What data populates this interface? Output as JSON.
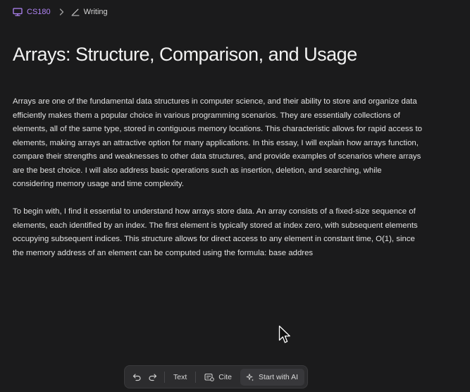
{
  "breadcrumb": {
    "course": "CS180",
    "document": "Writing"
  },
  "document": {
    "title": "Arrays: Structure, Comparison, and Usage",
    "paragraphs": [
      "Arrays are one of the fundamental data structures in computer science, and their ability to store and organize data efficiently makes them a popular choice in various programming scenarios. They are essentially collections of elements, all of the same type, stored in contiguous memory locations. This characteristic allows for rapid access to elements, making arrays an attractive option for many applications. In this essay, I will explain how arrays function, compare their strengths and weaknesses to other data structures, and provide examples of scenarios where arrays are the best choice. I will also address basic operations such as insertion, deletion, and searching, while considering memory usage and time complexity.",
      "To begin with, I find it essential to understand how arrays store data. An array consists of a fixed-size sequence of elements, each identified by an index. The first element is typically stored at index zero, with subsequent elements occupying subsequent indices. This structure allows for direct access to any element in constant time, O(1), since the memory address of an element can be computed using the formula: base addres"
    ]
  },
  "toolbar": {
    "text_label": "Text",
    "cite_label": "Cite",
    "ai_label": "Start with AI"
  },
  "colors": {
    "background": "#1b1b1c",
    "accent": "#b084f5",
    "toolbar_bg": "#2c2c2e"
  },
  "icons": {
    "course": "monitor-icon",
    "document": "pen-icon",
    "undo": "undo-icon",
    "redo": "redo-icon",
    "cite": "cite-icon",
    "ai": "sparkle-icon",
    "cursor": "mouse-pointer-icon"
  }
}
